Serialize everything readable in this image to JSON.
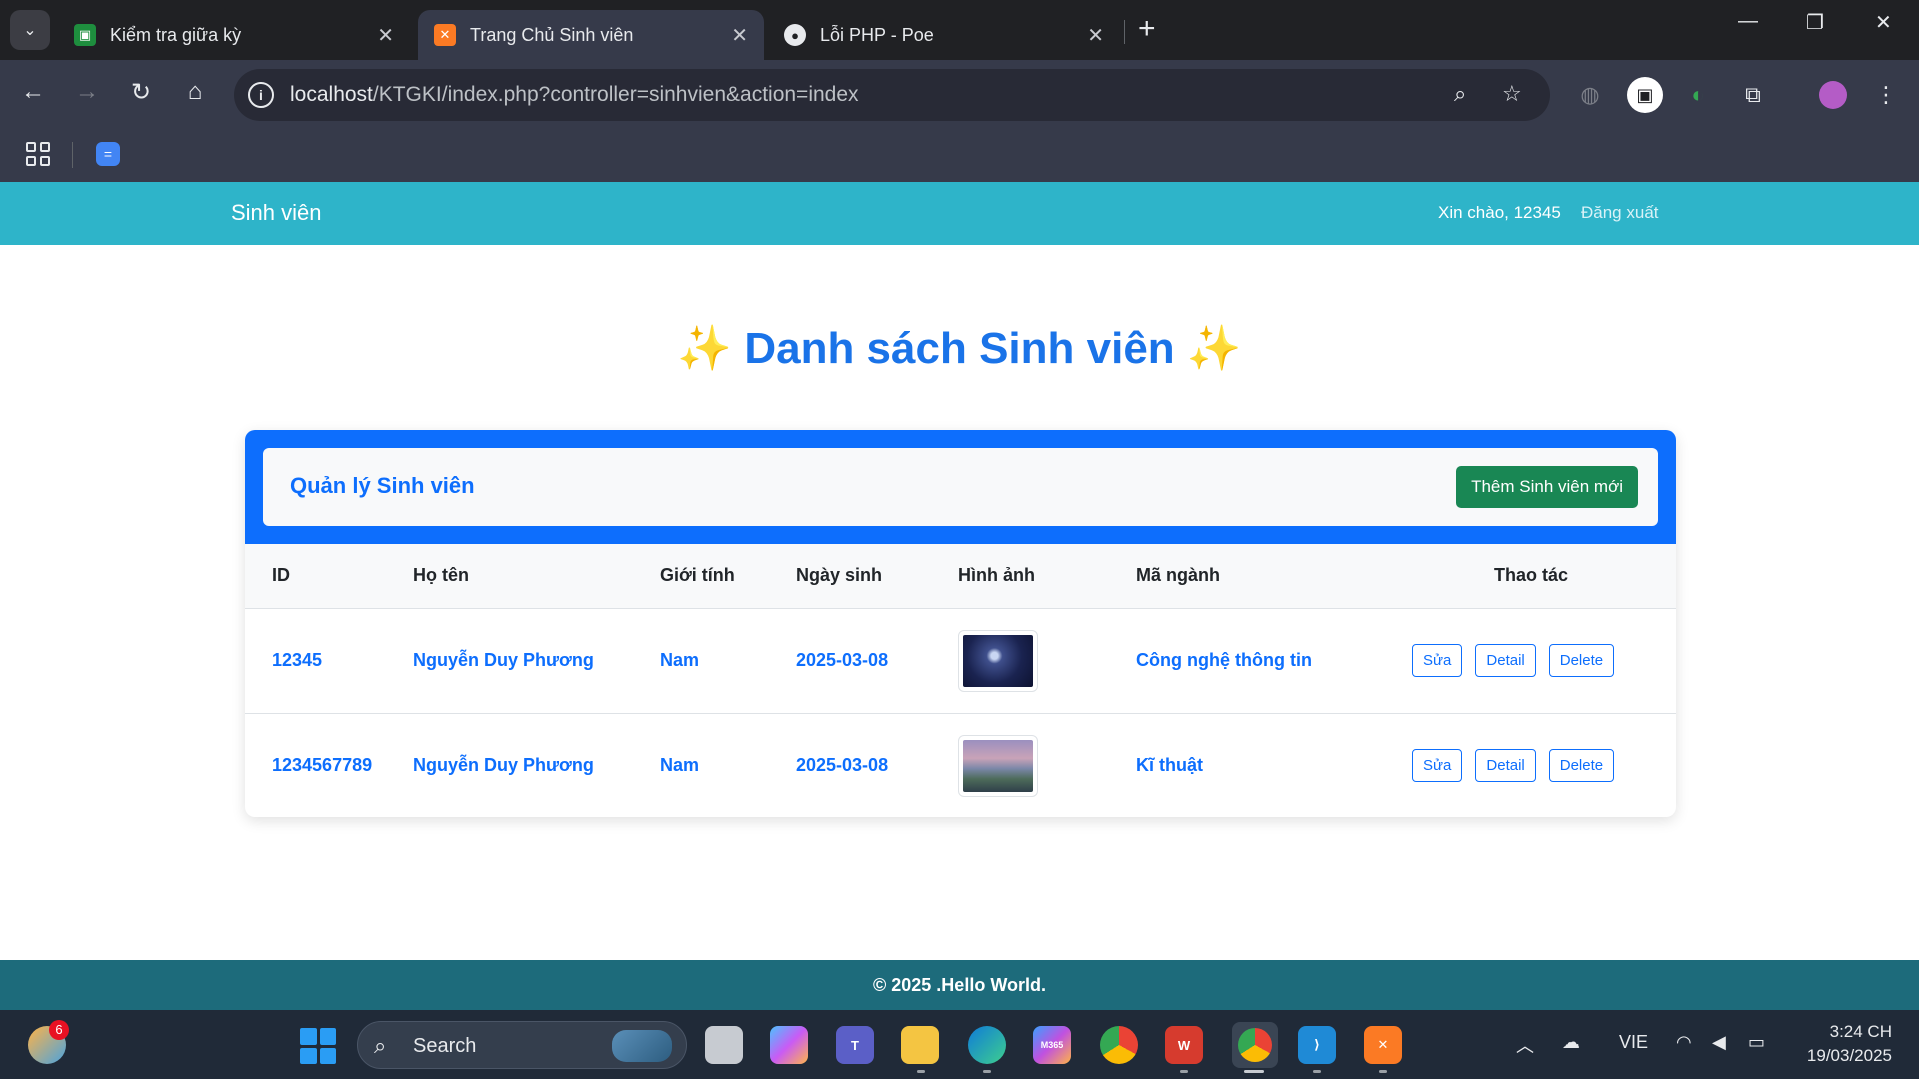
{
  "browser": {
    "tabs": [
      {
        "title": "Kiểm tra giữa kỳ",
        "active": false
      },
      {
        "title": "Trang Chủ Sinh viên",
        "active": true
      },
      {
        "title": "Lỗi PHP - Poe",
        "active": false
      }
    ],
    "url": "localhost/KTGKI/index.php?controller=sinhvien&action=index",
    "url_host": "localhost",
    "url_path": "/KTGKI/index.php?controller=sinhvien&action=index"
  },
  "navbar": {
    "brand": "Sinh viên",
    "greeting": "Xin chào, 12345",
    "logout": "Đăng xuất"
  },
  "page": {
    "title": "Danh sách Sinh viên",
    "spark_left": "✨",
    "spark_right": "✨",
    "card_title": "Quản lý Sinh viên",
    "add_button": "Thêm Sinh viên mới"
  },
  "table": {
    "headers": [
      "ID",
      "Họ tên",
      "Giới tính",
      "Ngày sinh",
      "Hình ảnh",
      "Mã ngành",
      "Thao tác"
    ],
    "rows": [
      {
        "id": "12345",
        "name": "Nguyễn Duy Phương",
        "gender": "Nam",
        "dob": "2025-03-08",
        "major": "Công nghệ thông tin"
      },
      {
        "id": "1234567789",
        "name": "Nguyễn Duy Phương",
        "gender": "Nam",
        "dob": "2025-03-08",
        "major": "Kĩ thuật"
      }
    ],
    "actions": {
      "edit": "Sửa",
      "detail": "Detail",
      "delete": "Delete"
    }
  },
  "footer": {
    "text": "© 2025 .Hello World."
  },
  "taskbar": {
    "search_placeholder": "Search",
    "weather_badge": "6",
    "language": "VIE",
    "time": "3:24 CH",
    "date": "19/03/2025"
  },
  "colors": {
    "navbar": "#2eb4c9",
    "primary": "#0d6efd",
    "success": "#198754",
    "footer": "#1d6b7b"
  }
}
